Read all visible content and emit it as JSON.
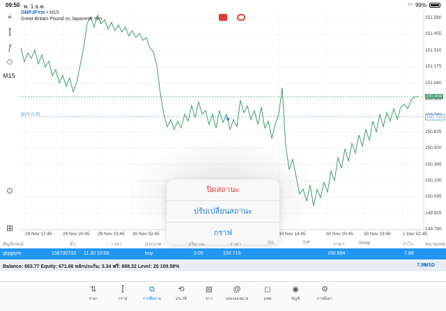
{
  "status": {
    "time": "09:50",
    "date": "พ. 1 ธ.ค.",
    "battery": "99%"
  },
  "chart": {
    "symbol": "GBPJPYm",
    "timeframe": "• M15",
    "description": "Great Britain Pound vs Japanese Yen",
    "timeframe_button": "M15",
    "buy_label": "BUY 0.05",
    "bid_tag": "150.894",
    "ask_tag": "150.715",
    "y_labels": [
      "151.580",
      "151.455",
      "151.310",
      "151.175",
      "151.040",
      "150.905",
      "150.770",
      "150.635",
      "150.500",
      "150.365",
      "150.230",
      "150.095",
      "149.925",
      "149.790"
    ],
    "x_labels": [
      "29 Nov 17:45",
      "29 Nov 20:45",
      "29 Nov 23:45",
      "30 Nov 02:45",
      "30 Nov 14:45",
      "30 Nov 20:45",
      "30 Nov 23:45",
      "1 Dec 02:45"
    ],
    "colors": {
      "line": "#3c9c6c",
      "bid_line": "#3c9c6c",
      "buy_line": "#7aa6d8",
      "accent": "#2196f3"
    }
  },
  "popup": {
    "close": "ปิดสถานะ",
    "modify": "ปรับเปลี่ยนสถานะ",
    "chart": "กราฟ"
  },
  "table": {
    "headers": [
      "สัญลักษณ์",
      "ตั๋ว",
      "เวลา",
      "ประเภท",
      "ปริมาณ",
      "ราคา",
      "S/L",
      "T/P",
      "ราคา",
      "Swap",
      "กำไร",
      "หมายเหตุ"
    ],
    "row": {
      "symbol": "gbpjpym",
      "ticket": "158730733",
      "time": "11.30 10:58",
      "type": "buy",
      "volume": "0.05",
      "open_price": "150.715",
      "price": "150.894",
      "profit": "7.89"
    }
  },
  "balance": {
    "text": "Balance: 663.77 Equity: 671.66 หลักประกัน: 3.34 ฟรี: 668.32 Level: 20 109.58%",
    "total": "7.89",
    "currency": "USD"
  },
  "tabs": [
    {
      "label": "ราคา",
      "icon": "updown-arrows-icon"
    },
    {
      "label": "กราฟ",
      "icon": "candles-icon"
    },
    {
      "label": "การซื้อขาย",
      "icon": "trade-chart-icon"
    },
    {
      "label": "ประวัติ",
      "icon": "history-icon"
    },
    {
      "label": "ข่าว",
      "icon": "news-icon"
    },
    {
      "label": "กล่องจดหมาย",
      "icon": "mail-icon"
    },
    {
      "label": "แชท",
      "icon": "chat-icon"
    },
    {
      "label": "บัญชี",
      "icon": "account-icon"
    },
    {
      "label": "การตั้งค่า",
      "icon": "settings-icon"
    }
  ]
}
